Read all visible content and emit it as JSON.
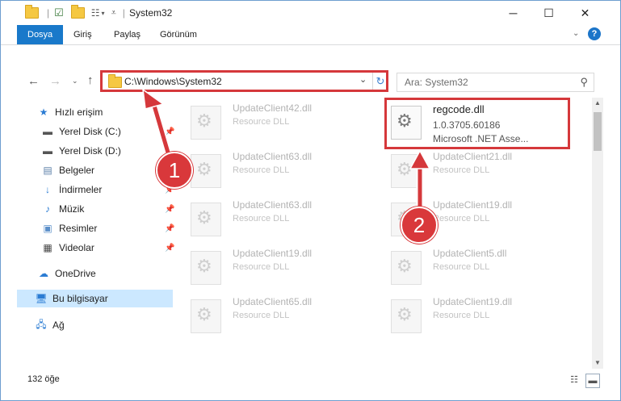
{
  "window": {
    "title": "System32",
    "minimize": "─",
    "maximize": "☐",
    "close": "✕"
  },
  "ribbon": {
    "tabs": [
      "Dosya",
      "Giriş",
      "Paylaş",
      "Görünüm"
    ]
  },
  "address": {
    "path": "C:\\Windows\\System32",
    "search_placeholder": "Ara: System32"
  },
  "sidebar": {
    "items": [
      {
        "label": "Hızlı erişim",
        "icon": "star-icon"
      },
      {
        "label": "Yerel Disk (C:)",
        "icon": "drive-icon"
      },
      {
        "label": "Yerel Disk (D:)",
        "icon": "drive-icon"
      },
      {
        "label": "Belgeler",
        "icon": "documents-icon"
      },
      {
        "label": "İndirmeler",
        "icon": "download-icon"
      },
      {
        "label": "Müzik",
        "icon": "music-icon"
      },
      {
        "label": "Resimler",
        "icon": "pictures-icon"
      },
      {
        "label": "Videolar",
        "icon": "video-icon"
      },
      {
        "label": "OneDrive",
        "icon": "cloud-icon"
      },
      {
        "label": "Bu bilgisayar",
        "icon": "computer-icon"
      },
      {
        "label": "Ağ",
        "icon": "network-icon"
      }
    ]
  },
  "files": {
    "left": [
      {
        "name": "UpdateClient42.dll",
        "desc": "Resource DLL"
      },
      {
        "name": "UpdateClient63.dll",
        "desc": "Resource DLL"
      },
      {
        "name": "UpdateClient63.dll",
        "desc": "Resource DLL"
      },
      {
        "name": "UpdateClient19.dll",
        "desc": "Resource DLL"
      },
      {
        "name": "UpdateClient65.dll",
        "desc": "Resource DLL"
      }
    ],
    "right": [
      {
        "name": "regcode.dll",
        "desc": "1.0.3705.60186",
        "desc2": "Microsoft .NET Asse..."
      },
      {
        "name": "UpdateClient21.dll",
        "desc": "Resource DLL"
      },
      {
        "name": "UpdateClient19.dll",
        "desc": "Resource DLL"
      },
      {
        "name": "UpdateClient5.dll",
        "desc": "Resource DLL"
      },
      {
        "name": "UpdateClient19.dll",
        "desc": "Resource DLL"
      }
    ]
  },
  "status": {
    "count": "132 öğe"
  },
  "annotations": {
    "step1": "1",
    "step2": "2",
    "color": "#d5383b"
  }
}
